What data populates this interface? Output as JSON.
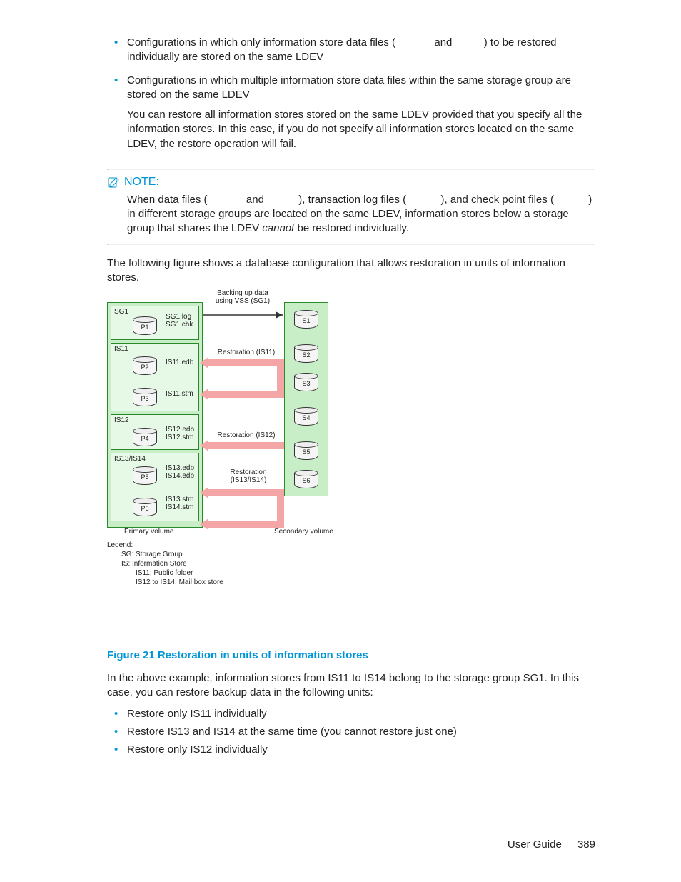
{
  "bullets_top": [
    {
      "pre": "Configurations in which only information store data files (",
      "mid": " and ",
      "post": ") to be restored individually are stored on the same LDEV"
    },
    {
      "pre": "Configurations in which multiple information store data files within the same storage group are stored on the same LDEV",
      "follow": "You can restore all information stores stored on the same LDEV provided that you specify all the information stores. In this case, if you do not specify all information stores located on the same LDEV, the restore operation will fail."
    }
  ],
  "note": {
    "label": "NOTE:",
    "body_pre": "When data files (",
    "body_mid1": " and ",
    "body_mid2": "), transaction log files (",
    "body_mid3": "), and check point files (",
    "body_post": ") in different storage groups are located on the same LDEV, information stores below a storage group that shares the LDEV ",
    "cannot": "cannot",
    "body_end": " be restored individually."
  },
  "para_before_figure": "The following figure shows a database configuration that allows restoration in units of information stores.",
  "diagram": {
    "backup_label": "Backing up data using VSS (SG1)",
    "pv_label": "Primary volume",
    "sv_label": "Secondary volume",
    "sg1": "SG1",
    "sg1_files": "SG1.log\nSG1.chk",
    "is11": "IS11",
    "is12": "IS12",
    "is1314": "IS13/IS14",
    "p": [
      "P1",
      "P2",
      "P3",
      "P4",
      "P5",
      "P6"
    ],
    "s": [
      "S1",
      "S2",
      "S3",
      "S4",
      "S5",
      "S6"
    ],
    "file_labels": {
      "p2": "IS11.edb",
      "p3": "IS11.stm",
      "p4": "IS12.edb\nIS12.stm",
      "p5": "IS13.edb\nIS14.edb",
      "p6": "IS13.stm\nIS14.stm"
    },
    "arrows": {
      "r11": "Restoration (IS11)",
      "r12": "Restoration (IS12)",
      "r1314": "Restoration\n(IS13/IS14)"
    },
    "legend": {
      "title": "Legend:",
      "l1": "SG: Storage Group",
      "l2": "IS: Information Store",
      "l3": "IS11: Public folder",
      "l4": "IS12 to IS14: Mail box store"
    }
  },
  "figure_caption": "Figure 21 Restoration in units of information stores",
  "para_after_figure": "In the above example, information stores from IS11 to IS14 belong to the storage group SG1. In this case, you can restore backup data in the following units:",
  "units": [
    "Restore only IS11 individually",
    "Restore IS13 and IS14 at the same time (you cannot restore just one)",
    "Restore only IS12 individually"
  ],
  "footer": {
    "guide": "User Guide",
    "page": "389"
  }
}
